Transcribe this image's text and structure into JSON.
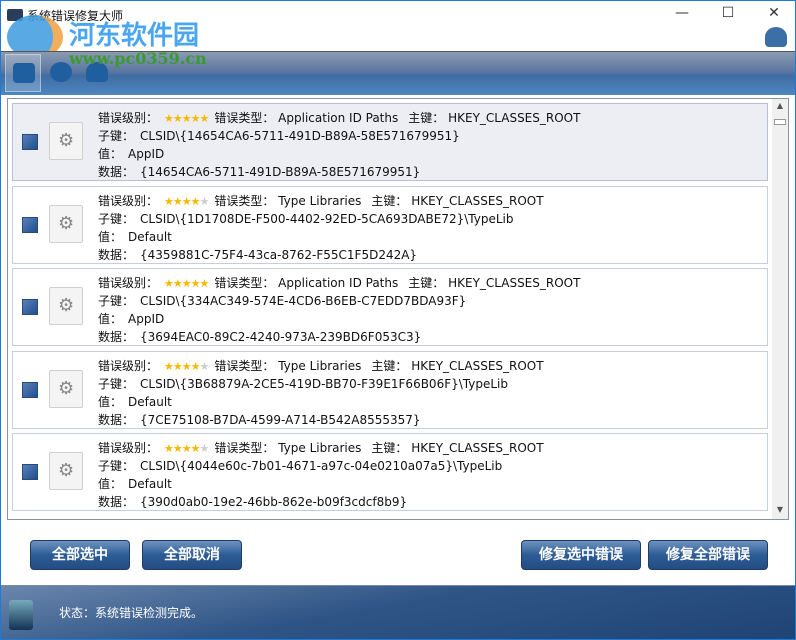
{
  "window": {
    "title": "系统错误修复大师",
    "watermark": "河东软件园",
    "watermark_url": "www.pc0359.cn",
    "controls": [
      "—",
      "☐",
      "✕"
    ]
  },
  "toolbar": {
    "items": [
      "computer-icon",
      "mouse-icon",
      "qq-icon"
    ]
  },
  "labels": {
    "level": "错误级别：",
    "type": "错误类型：",
    "root": "主键：",
    "subkey": "子键：",
    "value": "值：",
    "data": "数据："
  },
  "rows": [
    {
      "stars": 5,
      "type": "Application ID Paths",
      "root": "HKEY_CLASSES_ROOT",
      "subkey": "CLSID\\{14654CA6-5711-491D-B89A-58E571679951}",
      "value": "AppID",
      "data": "{14654CA6-5711-491D-B89A-58E571679951}",
      "selected": true
    },
    {
      "stars": 4.5,
      "type": "Type Libraries",
      "root": "HKEY_CLASSES_ROOT",
      "subkey": "CLSID\\{1D1708DE-F500-4402-92ED-5CA693DABE72}\\TypeLib",
      "value": "Default",
      "data": "{4359881C-75F4-43ca-8762-F55C1F5D242A}"
    },
    {
      "stars": 5,
      "type": "Application ID Paths",
      "root": "HKEY_CLASSES_ROOT",
      "subkey": "CLSID\\{334AC349-574E-4CD6-B6EB-C7EDD7BDA93F}",
      "value": "AppID",
      "data": "{3694EAC0-89C2-4240-973A-239BD6F053C3}"
    },
    {
      "stars": 4.5,
      "type": "Type Libraries",
      "root": "HKEY_CLASSES_ROOT",
      "subkey": "CLSID\\{3B68879A-2CE5-419D-BB70-F39E1F66B06F}\\TypeLib",
      "value": "Default",
      "data": "{7CE75108-B7DA-4599-A714-B542A8555357}"
    },
    {
      "stars": 4.5,
      "type": "Type Libraries",
      "root": "HKEY_CLASSES_ROOT",
      "subkey": "CLSID\\{4044e60c-7b01-4671-a97c-04e0210a07a5}\\TypeLib",
      "value": "Default",
      "data": "{390d0ab0-19e2-46bb-862e-b09f3cdcf8b9}"
    }
  ],
  "buttons": {
    "select_all": "全部选中",
    "deselect_all": "全部取消",
    "fix_selected": "修复选中错误",
    "fix_all": "修复全部错误"
  },
  "status": "状态：系统错误检测完成。"
}
